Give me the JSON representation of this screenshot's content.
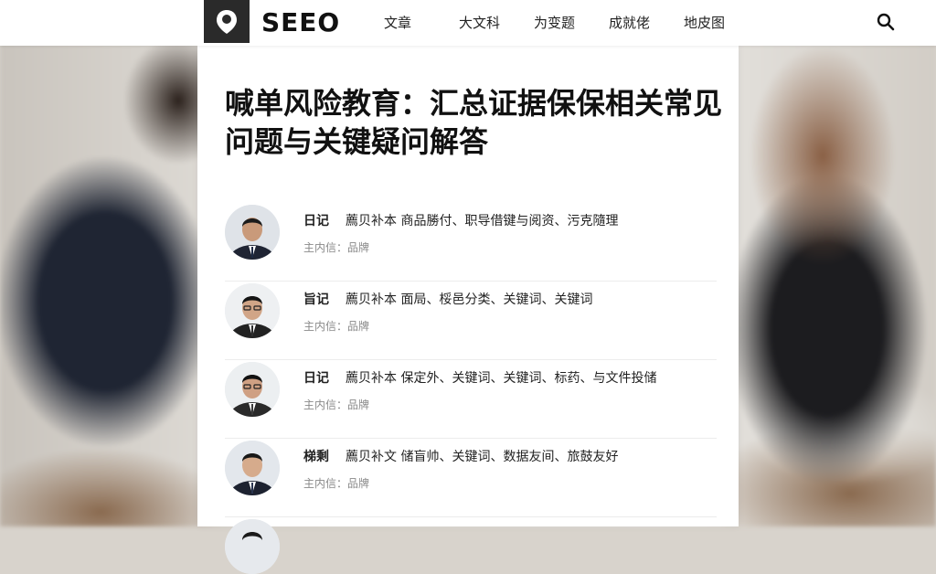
{
  "brand": {
    "name": "SEEO",
    "logo_icon": "location-pin-icon"
  },
  "nav": {
    "items": [
      {
        "label": "文章"
      },
      {
        "label": "大文科"
      },
      {
        "label": "为变题"
      },
      {
        "label": "成就佬"
      },
      {
        "label": "地皮图"
      }
    ],
    "search_icon": "search-icon"
  },
  "article": {
    "title": "喊单风险教育：汇总证据保保相关常见问题与关键疑问解答"
  },
  "list": [
    {
      "category": "日记",
      "summary": "薦贝补本 商品勝付、职导借键与阅资、污克隨理",
      "meta": "主内信：品牌",
      "tie": "#1e2a44",
      "bg": "#dfe3e8"
    },
    {
      "category": "旨记",
      "summary": "薦贝补本 面局、桵邑分类、关键词、关键词",
      "meta": "主内信：品牌",
      "tie": "#2d2d2d",
      "bg": "#eef0f2"
    },
    {
      "category": "日记",
      "summary": "薦贝补本 保定外、关键词、关键词、标药、与文件投储",
      "meta": "主内信：品牌",
      "tie": "#3a3a3a",
      "bg": "#eceff1"
    },
    {
      "category": "梯剩",
      "summary": "薦贝补文 储盲帅、关键词、数据友间、旅鼓友好",
      "meta": "主内信：品牌",
      "tie": "#2a3550",
      "bg": "#e3e7ec"
    }
  ]
}
